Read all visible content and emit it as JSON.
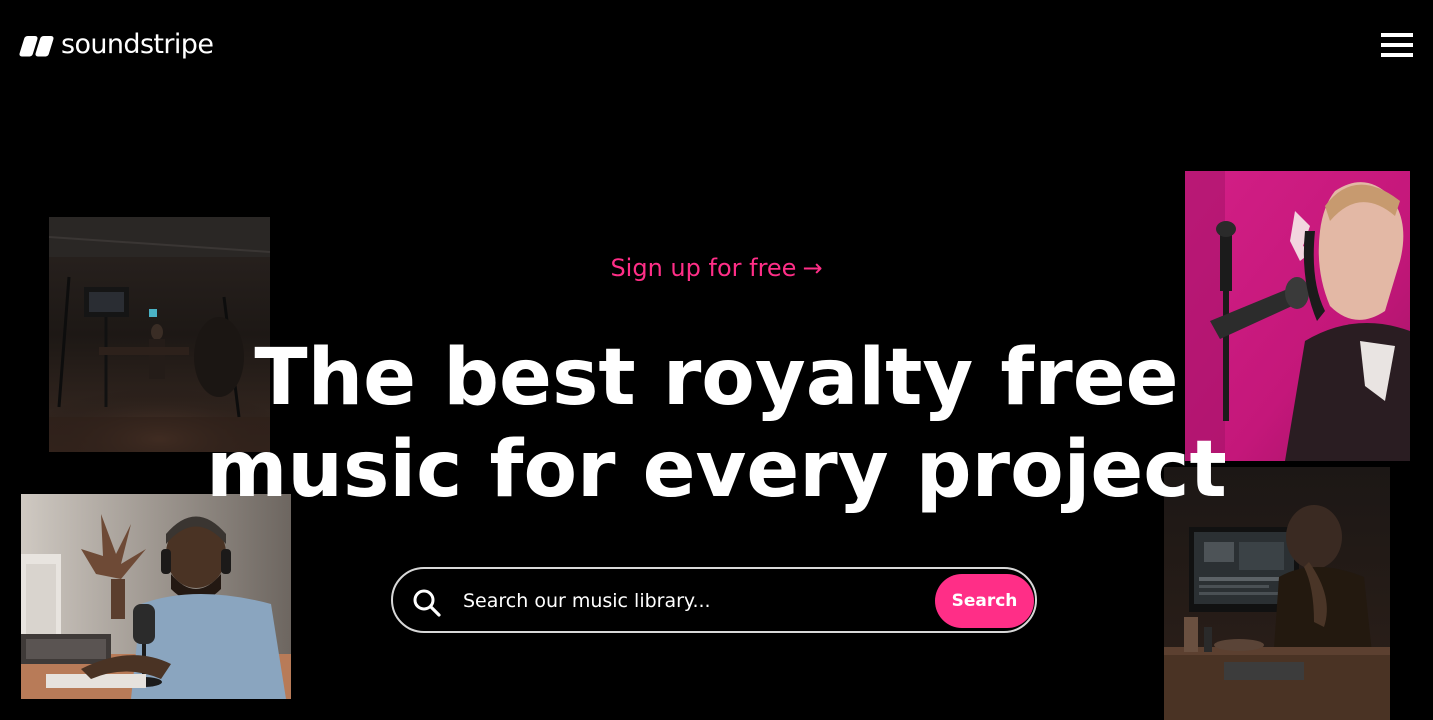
{
  "header": {
    "brand_name": "soundstripe",
    "logo_icon": "soundstripe-logo-icon",
    "menu_icon": "hamburger-menu-icon"
  },
  "hero": {
    "signup_label": "Sign up for free",
    "signup_arrow": "→",
    "title_line1": "The best royalty free",
    "title_line2": "music for every project"
  },
  "search": {
    "placeholder": "Search our music library...",
    "button_label": "Search",
    "icon": "search-icon"
  },
  "photos": [
    {
      "name": "studio-photo"
    },
    {
      "name": "producer-photo"
    },
    {
      "name": "podcaster-photo"
    },
    {
      "name": "editor-photo"
    }
  ],
  "colors": {
    "background": "#000000",
    "accent": "#ff2e87",
    "text": "#ffffff"
  }
}
